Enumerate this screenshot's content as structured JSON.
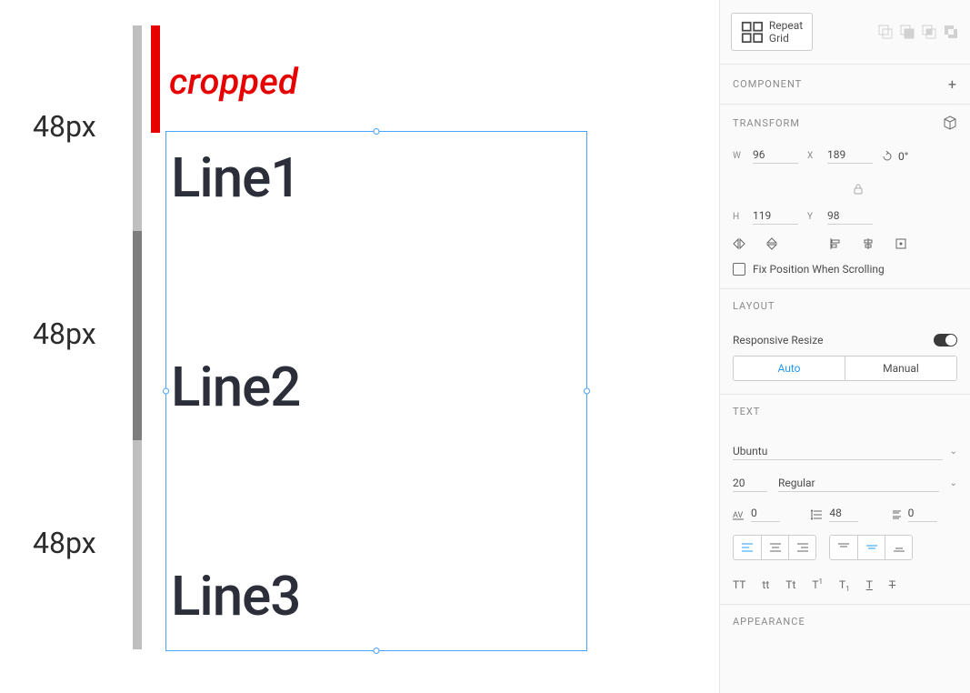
{
  "canvas": {
    "ruler_labels": [
      "48px",
      "48px",
      "48px"
    ],
    "cropped_label": "cropped",
    "lines": [
      "Line1",
      "Line2",
      "Line3"
    ]
  },
  "panel": {
    "repeat_grid_label": "Repeat Grid",
    "component": {
      "title": "COMPONENT"
    },
    "transform": {
      "title": "TRANSFORM",
      "w": "96",
      "x": "189",
      "h": "119",
      "y": "98",
      "rotation": "0°"
    },
    "fix_position_label": "Fix Position When Scrolling",
    "layout": {
      "title": "LAYOUT",
      "responsive_label": "Responsive Resize",
      "auto_label": "Auto",
      "manual_label": "Manual"
    },
    "text": {
      "title": "TEXT",
      "font_family": "Ubuntu",
      "font_size": "20",
      "font_weight": "Regular",
      "char_spacing": "0",
      "line_spacing": "48",
      "para_spacing": "0"
    },
    "appearance": {
      "title": "APPEARANCE"
    }
  }
}
